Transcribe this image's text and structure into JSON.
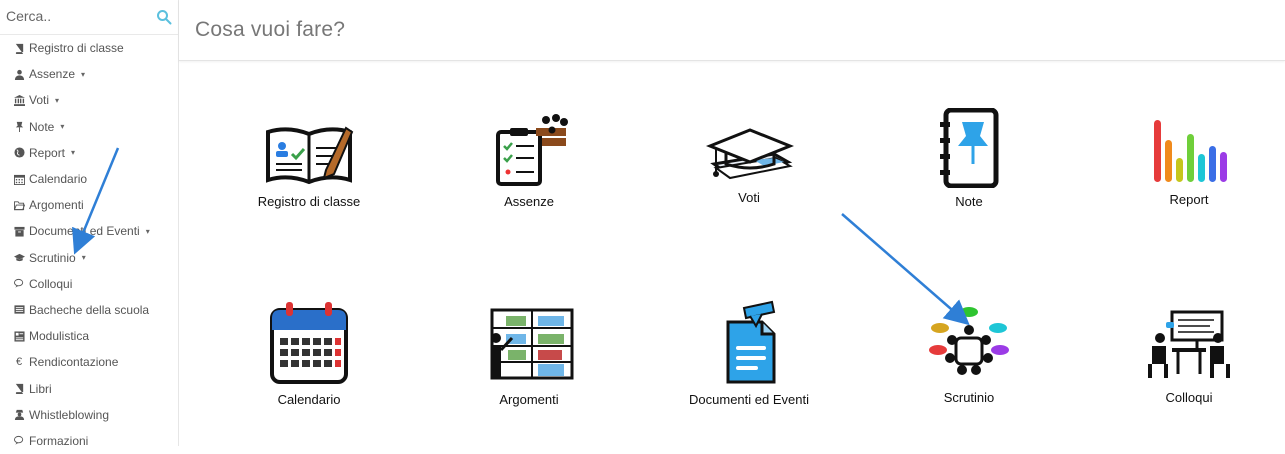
{
  "search": {
    "placeholder": "Cerca.."
  },
  "sidebar": {
    "items": [
      {
        "label": "Registro di classe",
        "icon": "book-icon",
        "has_caret": false
      },
      {
        "label": "Assenze",
        "icon": "user-icon",
        "has_caret": true
      },
      {
        "label": "Voti",
        "icon": "bank-icon",
        "has_caret": true
      },
      {
        "label": "Note",
        "icon": "pushpin-icon",
        "has_caret": true
      },
      {
        "label": "Report",
        "icon": "globe-icon",
        "has_caret": true
      },
      {
        "label": "Calendario",
        "icon": "calendar-icon",
        "has_caret": false
      },
      {
        "label": "Argomenti",
        "icon": "folder-open-icon",
        "has_caret": false
      },
      {
        "label": "Documenti ed Eventi",
        "icon": "archive-icon",
        "has_caret": true
      },
      {
        "label": "Scrutinio",
        "icon": "graduation-cap-icon",
        "has_caret": true
      },
      {
        "label": "Colloqui",
        "icon": "comments-icon",
        "has_caret": false
      },
      {
        "label": "Bacheche della scuola",
        "icon": "board-icon",
        "has_caret": false
      },
      {
        "label": "Modulistica",
        "icon": "forms-icon",
        "has_caret": false
      },
      {
        "label": "Rendicontazione",
        "icon": "euro-icon",
        "has_caret": false
      },
      {
        "label": "Libri",
        "icon": "book-icon",
        "has_caret": false
      },
      {
        "label": "Whistleblowing",
        "icon": "user-secret-icon",
        "has_caret": false
      },
      {
        "label": "Formazioni",
        "icon": "comments-icon",
        "has_caret": false
      }
    ],
    "caret_glyph": "▾"
  },
  "main": {
    "title": "Cosa vuoi fare?",
    "tiles": [
      {
        "label": "Registro di classe",
        "icon": "class-register-icon"
      },
      {
        "label": "Assenze",
        "icon": "attendance-icon"
      },
      {
        "label": "Voti",
        "icon": "grades-icon"
      },
      {
        "label": "Note",
        "icon": "notes-icon"
      },
      {
        "label": "Report",
        "icon": "report-icon"
      },
      {
        "label": "Calendario",
        "icon": "calendar-icon"
      },
      {
        "label": "Argomenti",
        "icon": "topics-icon"
      },
      {
        "label": "Documenti ed Eventi",
        "icon": "documents-icon"
      },
      {
        "label": "Scrutinio",
        "icon": "meeting-icon"
      },
      {
        "label": "Colloqui",
        "icon": "interview-icon"
      }
    ]
  },
  "colors": {
    "accent": "#5bc0de",
    "annotation_arrow": "#2f7fd6",
    "report_bars": [
      "#e63b3b",
      "#f08a1c",
      "#c6c61c",
      "#6fcf3a",
      "#1ec6d6",
      "#3b6ee6",
      "#9b3be6"
    ]
  }
}
